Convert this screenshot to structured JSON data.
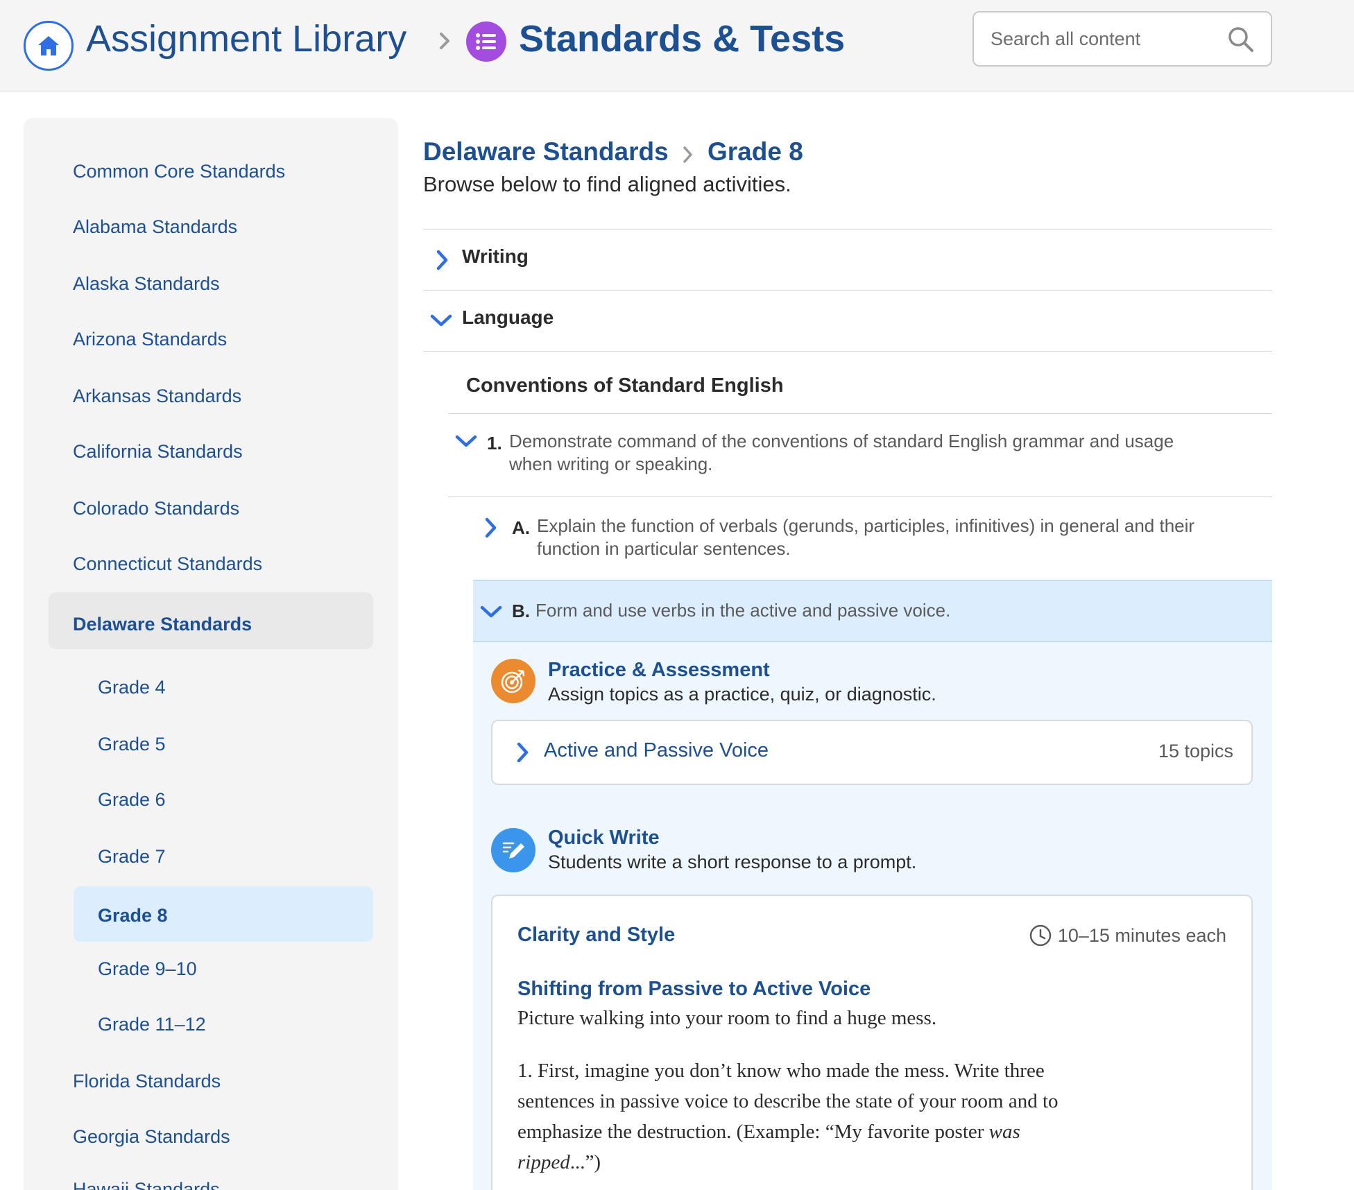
{
  "header": {
    "library_title": "Assignment Library",
    "section_title": "Standards & Tests",
    "search_placeholder": "Search all content"
  },
  "sidebar": {
    "items": [
      "Common Core Standards",
      "Alabama Standards",
      "Alaska Standards",
      "Arizona Standards",
      "Arkansas Standards",
      "California Standards",
      "Colorado Standards",
      "Connecticut Standards",
      "Delaware Standards"
    ],
    "grades": [
      "Grade 4",
      "Grade 5",
      "Grade 6",
      "Grade 7",
      "Grade 8",
      "Grade 9–10",
      "Grade 11–12"
    ],
    "items_after": [
      "Florida Standards",
      "Georgia Standards",
      "Hawaii Standards"
    ],
    "active_state": "Delaware Standards",
    "active_grade": "Grade 8"
  },
  "main": {
    "breadcrumb_state": "Delaware Standards",
    "breadcrumb_grade": "Grade 8",
    "subtitle": "Browse below to find aligned activities.",
    "writing_label": "Writing",
    "language_label": "Language",
    "conventions_title": "Conventions of Standard English",
    "standard_1": {
      "num": "1.",
      "line1": "Demonstrate command of the conventions of standard English grammar and usage",
      "line2": "when writing or speaking."
    },
    "standard_a": {
      "num": "A.",
      "line1": "Explain the function of verbals (gerunds, participles, infinitives) in general and their",
      "line2": "function in particular sentences."
    },
    "standard_b": {
      "num": "B.",
      "text": "Form and use verbs in the active and passive voice."
    },
    "practice": {
      "title": "Practice & Assessment",
      "desc": "Assign topics as a practice, quiz, or diagnostic.",
      "topic_title": "Active and Passive Voice",
      "topic_count": "15 topics"
    },
    "quick_write": {
      "title": "Quick Write",
      "desc": "Students write a short response to a prompt.",
      "card_title": "Clarity and Style",
      "time": "10–15 minutes each",
      "prompt_title": "Shifting from Passive to Active Voice",
      "prompt_lead": "Picture walking into your room to find a huge mess.",
      "prompt_body_1": "1. First, imagine you don’t know who made the mess. Write three",
      "prompt_body_2": "sentences in passive voice to describe the state of your room and to",
      "prompt_body_3a": "emphasize the destruction. (Example: “My favorite poster ",
      "prompt_body_3b": "was",
      "prompt_body_4a": "ripped",
      "prompt_body_4b": "...”)"
    }
  },
  "colors": {
    "brand_blue": "#1d4f93",
    "accent_blue": "#2f6fe4",
    "purple": "#a24ce0",
    "orange": "#ec8a2f",
    "light_blue": "#dceefe"
  },
  "icons": [
    "home-icon",
    "chevron-right-icon",
    "list-icon",
    "search-icon",
    "chevron-down-icon",
    "target-icon",
    "pencil-icon",
    "clock-icon"
  ]
}
